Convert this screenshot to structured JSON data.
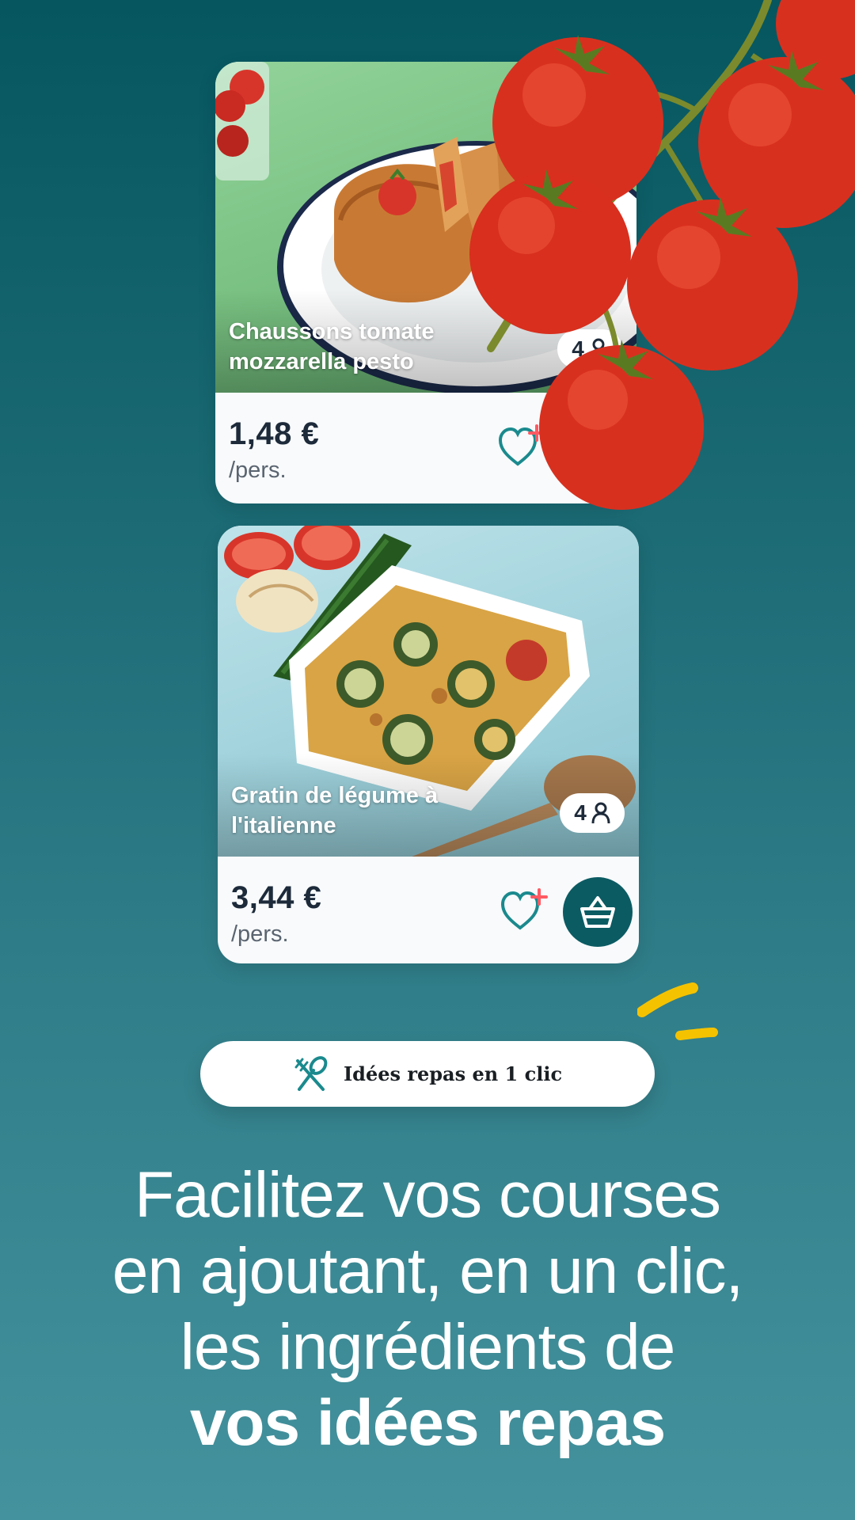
{
  "recipes": [
    {
      "title": "Chaussons tomate mozzarella pesto",
      "servings": "4",
      "price": "1,48 €",
      "unit": "/pers."
    },
    {
      "title": "Gratin de légume à l'italienne",
      "servings": "4",
      "price": "3,44 €",
      "unit": "/pers."
    }
  ],
  "pill": {
    "label": "Idées repas en 1 clic",
    "icon": "cutlery-icon"
  },
  "headline": {
    "line1": "Facilitez vos courses",
    "line2": "en ajoutant, en un clic,",
    "line3": "les ingrédients de",
    "line4": "vos idées repas"
  },
  "colors": {
    "background_top": "#05565f",
    "background_bottom": "#44929d",
    "accent_teal": "#0b5b63",
    "heart_teal": "#1a8a8e",
    "plus_red": "#ff5a62",
    "accent_yellow": "#f5c200"
  }
}
